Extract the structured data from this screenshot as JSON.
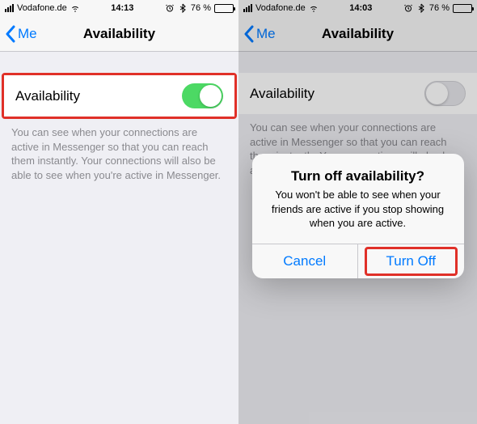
{
  "left": {
    "status": {
      "carrier": "Vodafone.de",
      "time": "14:13",
      "battery_pct": "76 %",
      "battery_fill_pct": 76
    },
    "nav": {
      "back": "Me",
      "title": "Availability"
    },
    "setting": {
      "label": "Availability",
      "toggle_on": true
    },
    "desc": "You can see when your connections are active in Messenger so that you can reach them instantly. Your connections will also be able to see when you're active in Messenger."
  },
  "right": {
    "status": {
      "carrier": "Vodafone.de",
      "time": "14:03",
      "battery_pct": "76 %",
      "battery_fill_pct": 76
    },
    "nav": {
      "back": "Me",
      "title": "Availability"
    },
    "setting": {
      "label": "Availability",
      "toggle_on": false
    },
    "desc": "You can see when your connections are active in Messenger so that you can reach them instantly. Your connections will also be able to see when you're active in Messenger.",
    "alert": {
      "title": "Turn off availability?",
      "message": "You won't be able to see when your friends are active if you stop showing when you are active.",
      "cancel": "Cancel",
      "confirm": "Turn Off"
    }
  },
  "icons": {
    "alarm": "⏰",
    "bluetooth": "✶"
  }
}
